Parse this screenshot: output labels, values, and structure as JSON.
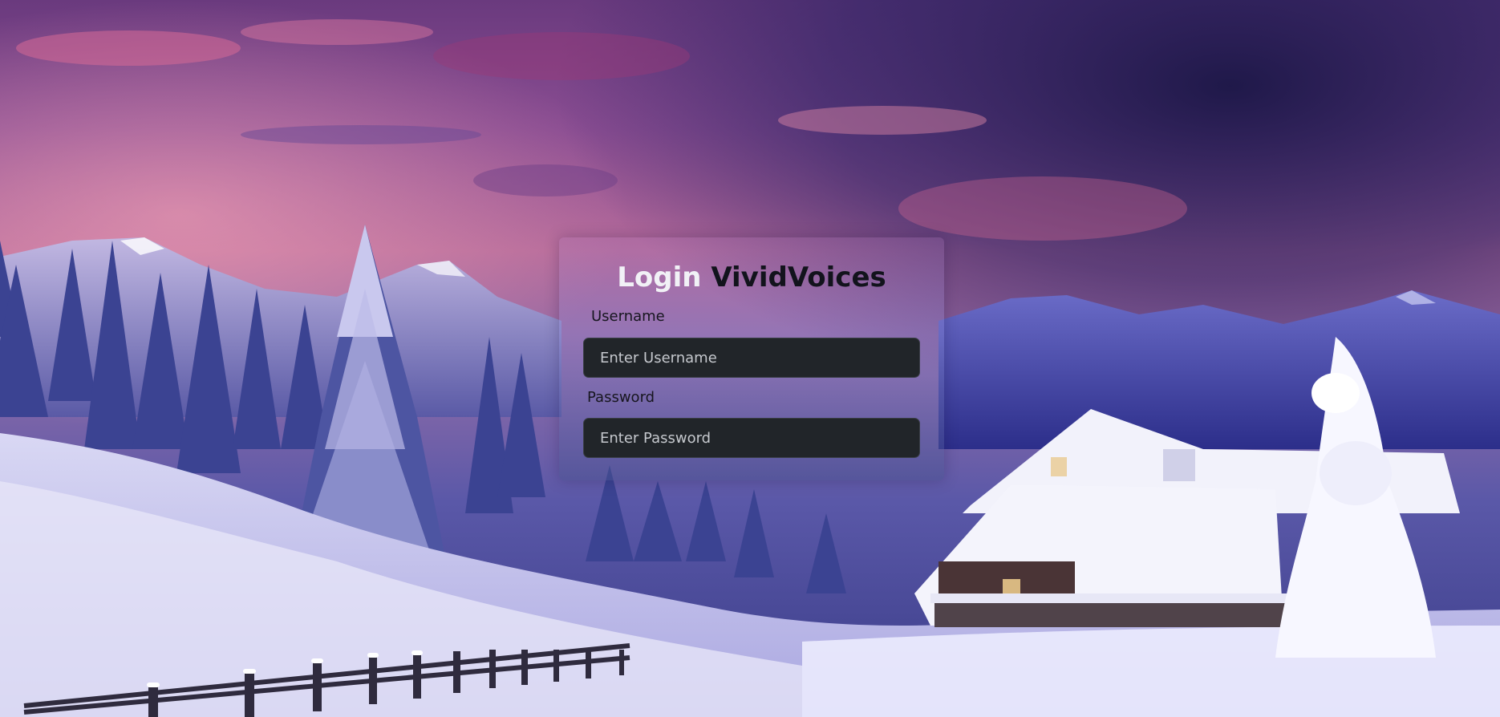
{
  "login": {
    "title_prefix": "Login",
    "title_brand": "VividVoices",
    "username_label": "Username",
    "username_placeholder": "Enter Username",
    "username_value": "",
    "password_label": "Password",
    "password_placeholder": "Enter Password",
    "password_value": ""
  },
  "colors": {
    "input_background": "#212529",
    "title_prefix": "#f1f1f6",
    "title_brand": "#12131c"
  }
}
